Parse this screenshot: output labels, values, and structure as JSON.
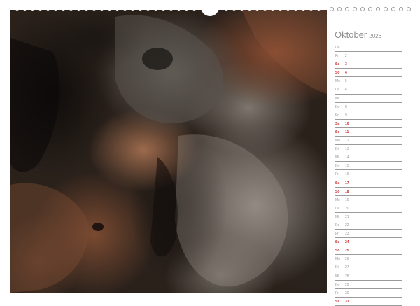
{
  "calendar": {
    "month": "Oktober",
    "year": "2026",
    "days": [
      {
        "wd": "Do",
        "day": "1",
        "weekend": false
      },
      {
        "wd": "Fr",
        "day": "2",
        "weekend": false
      },
      {
        "wd": "Sa",
        "day": "3",
        "weekend": true
      },
      {
        "wd": "So",
        "day": "4",
        "weekend": true
      },
      {
        "wd": "Mo",
        "day": "5",
        "weekend": false
      },
      {
        "wd": "Di",
        "day": "6",
        "weekend": false
      },
      {
        "wd": "Mi",
        "day": "7",
        "weekend": false
      },
      {
        "wd": "Do",
        "day": "8",
        "weekend": false
      },
      {
        "wd": "Fr",
        "day": "9",
        "weekend": false
      },
      {
        "wd": "Sa",
        "day": "10",
        "weekend": true
      },
      {
        "wd": "So",
        "day": "11",
        "weekend": true
      },
      {
        "wd": "Mo",
        "day": "12",
        "weekend": false
      },
      {
        "wd": "Di",
        "day": "13",
        "weekend": false
      },
      {
        "wd": "Mi",
        "day": "14",
        "weekend": false
      },
      {
        "wd": "Do",
        "day": "15",
        "weekend": false
      },
      {
        "wd": "Fr",
        "day": "16",
        "weekend": false
      },
      {
        "wd": "Sa",
        "day": "17",
        "weekend": true
      },
      {
        "wd": "So",
        "day": "18",
        "weekend": true
      },
      {
        "wd": "Mo",
        "day": "19",
        "weekend": false
      },
      {
        "wd": "Di",
        "day": "20",
        "weekend": false
      },
      {
        "wd": "Mi",
        "day": "21",
        "weekend": false
      },
      {
        "wd": "Do",
        "day": "22",
        "weekend": false
      },
      {
        "wd": "Fr",
        "day": "23",
        "weekend": false
      },
      {
        "wd": "Sa",
        "day": "24",
        "weekend": true
      },
      {
        "wd": "So",
        "day": "25",
        "weekend": true
      },
      {
        "wd": "Mo",
        "day": "26",
        "weekend": false
      },
      {
        "wd": "Di",
        "day": "27",
        "weekend": false
      },
      {
        "wd": "Mi",
        "day": "28",
        "weekend": false
      },
      {
        "wd": "Do",
        "day": "29",
        "weekend": false
      },
      {
        "wd": "Fr",
        "day": "30",
        "weekend": false
      },
      {
        "wd": "Sa",
        "day": "31",
        "weekend": true
      }
    ]
  },
  "colors": {
    "weekend": "#c62828",
    "weekday": "#9a9a9a",
    "title": "#8f8f8f"
  }
}
